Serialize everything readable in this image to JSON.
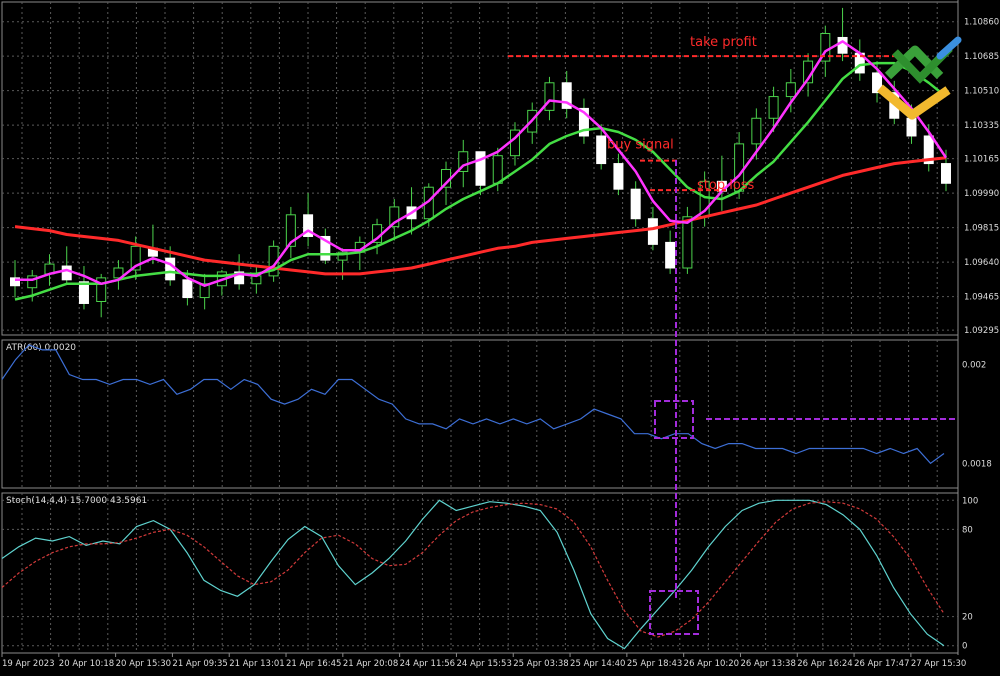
{
  "chart_data": [
    {
      "type": "candlestick",
      "panel": "price",
      "yaxis_ticks": [
        "1.10860",
        "1.10685",
        "1.10510",
        "1.10335",
        "1.10165",
        "1.09990",
        "1.09815",
        "1.09640",
        "1.09465",
        "1.09295"
      ],
      "ylim": [
        1.0927,
        1.1096
      ],
      "candles": [
        [
          1.0956,
          1.0965,
          1.0946,
          1.0952
        ],
        [
          1.0951,
          1.096,
          1.0944,
          1.0957
        ],
        [
          1.0958,
          1.0968,
          1.0952,
          1.0963
        ],
        [
          1.0962,
          1.0972,
          1.0953,
          1.0955
        ],
        [
          1.0954,
          1.0962,
          1.094,
          1.0943
        ],
        [
          1.0944,
          1.0958,
          1.0936,
          1.0956
        ],
        [
          1.0956,
          1.0965,
          1.095,
          1.0961
        ],
        [
          1.096,
          1.0977,
          1.0955,
          1.0972
        ],
        [
          1.0971,
          1.0983,
          1.0963,
          1.0967
        ],
        [
          1.0966,
          1.0972,
          1.0952,
          1.0955
        ],
        [
          1.0955,
          1.096,
          1.0942,
          1.0946
        ],
        [
          1.0946,
          1.0958,
          1.094,
          1.0953
        ],
        [
          1.0952,
          1.096,
          1.0947,
          1.0959
        ],
        [
          1.0959,
          1.0968,
          1.095,
          1.0953
        ],
        [
          1.0953,
          1.0962,
          1.0948,
          1.0957
        ],
        [
          1.0957,
          1.0975,
          1.0954,
          1.0972
        ],
        [
          1.0972,
          1.0992,
          1.0966,
          1.0988
        ],
        [
          1.0988,
          1.0999,
          1.0972,
          1.0977
        ],
        [
          1.0977,
          1.0981,
          1.0963,
          1.0965
        ],
        [
          1.0965,
          1.0971,
          1.0955,
          1.0969
        ],
        [
          1.0969,
          1.0977,
          1.096,
          1.0974
        ],
        [
          1.0974,
          1.0986,
          1.0968,
          1.0983
        ],
        [
          1.0982,
          1.0996,
          1.0975,
          1.0992
        ],
        [
          1.0992,
          1.1002,
          1.0978,
          1.0986
        ],
        [
          1.0986,
          1.1004,
          1.0982,
          1.1002
        ],
        [
          1.1002,
          1.1015,
          1.0993,
          1.1011
        ],
        [
          1.101,
          1.1026,
          1.1002,
          1.102
        ],
        [
          1.102,
          1.1017,
          1.0998,
          1.1003
        ],
        [
          1.1004,
          1.1022,
          1.1,
          1.1018
        ],
        [
          1.1018,
          1.1035,
          1.1013,
          1.1031
        ],
        [
          1.103,
          1.1045,
          1.1024,
          1.1041
        ],
        [
          1.1041,
          1.1058,
          1.1036,
          1.1055
        ],
        [
          1.1055,
          1.1061,
          1.1037,
          1.1042
        ],
        [
          1.1042,
          1.1047,
          1.1024,
          1.1028
        ],
        [
          1.1028,
          1.1034,
          1.1011,
          1.1014
        ],
        [
          1.1014,
          1.1019,
          1.0998,
          1.1001
        ],
        [
          1.1001,
          1.1005,
          1.0982,
          1.0986
        ],
        [
          1.0986,
          1.0992,
          1.097,
          1.0973
        ],
        [
          1.0974,
          1.098,
          1.0958,
          1.0961
        ],
        [
          1.0961,
          1.0992,
          1.0958,
          1.0987
        ],
        [
          1.0987,
          1.101,
          1.0982,
          1.1005
        ],
        [
          1.1005,
          1.1018,
          1.099,
          1.1
        ],
        [
          1.1,
          1.103,
          1.0996,
          1.1024
        ],
        [
          1.1024,
          1.1042,
          1.1016,
          1.1037
        ],
        [
          1.1037,
          1.1053,
          1.103,
          1.1048
        ],
        [
          1.1048,
          1.1062,
          1.104,
          1.1055
        ],
        [
          1.1055,
          1.107,
          1.1048,
          1.1066
        ],
        [
          1.1066,
          1.1084,
          1.1058,
          1.108
        ],
        [
          1.1078,
          1.1093,
          1.1066,
          1.107
        ],
        [
          1.107,
          1.1077,
          1.1056,
          1.106
        ],
        [
          1.106,
          1.1066,
          1.1045,
          1.105
        ],
        [
          1.105,
          1.1056,
          1.1034,
          1.1037
        ],
        [
          1.1037,
          1.1044,
          1.1024,
          1.1028
        ],
        [
          1.1028,
          1.1034,
          1.101,
          1.1014
        ],
        [
          1.1014,
          1.1021,
          1.1,
          1.1004
        ]
      ],
      "series": [
        {
          "name": "",
          "color": "#ff2a2a",
          "values": [
            1.0982,
            1.0981,
            1.098,
            1.0978,
            1.0977,
            1.0976,
            1.0975,
            1.0973,
            1.0971,
            1.0969,
            1.0967,
            1.0965,
            1.0964,
            1.0963,
            1.0962,
            1.0961,
            1.096,
            1.0959,
            1.0958,
            1.0958,
            1.0958,
            1.0959,
            1.096,
            1.0961,
            1.0963,
            1.0965,
            1.0967,
            1.0969,
            1.0971,
            1.0972,
            1.0974,
            1.0975,
            1.0976,
            1.0977,
            1.0978,
            1.0979,
            1.098,
            1.0981,
            1.0983,
            1.0985,
            1.0987,
            1.0989,
            1.0991,
            1.0993,
            1.0996,
            1.0999,
            1.1002,
            1.1005,
            1.1008,
            1.101,
            1.1012,
            1.1014,
            1.1015,
            1.1016,
            1.1017
          ]
        },
        {
          "name": "",
          "color": "#44dd44",
          "values": [
            1.0945,
            1.0947,
            1.095,
            1.0953,
            1.0953,
            1.0953,
            1.0955,
            1.0957,
            1.0958,
            1.0959,
            1.0958,
            1.0957,
            1.0957,
            1.0958,
            1.0958,
            1.096,
            1.0965,
            1.0968,
            1.0968,
            1.0968,
            1.0969,
            1.0972,
            1.0976,
            1.098,
            1.0985,
            1.0991,
            1.0996,
            1.1,
            1.1004,
            1.101,
            1.1016,
            1.1024,
            1.1028,
            1.1031,
            1.1032,
            1.103,
            1.1026,
            1.102,
            1.1011,
            1.1002,
            1.0997,
            1.0996,
            1.1,
            1.1008,
            1.1015,
            1.1025,
            1.1035,
            1.1046,
            1.1057,
            1.1064,
            1.1065,
            1.1065,
            1.1061,
            1.1055,
            1.1048
          ]
        },
        {
          "name": "",
          "color": "#ff33ff",
          "values": [
            1.0955,
            1.0955,
            1.0958,
            1.096,
            1.0957,
            1.0953,
            1.0955,
            1.0962,
            1.0966,
            1.0963,
            1.0956,
            1.0952,
            1.0955,
            1.0958,
            1.0957,
            1.0962,
            1.0974,
            1.098,
            1.0975,
            1.097,
            1.097,
            1.0976,
            1.0984,
            1.0989,
            1.0995,
            1.1004,
            1.1013,
            1.1016,
            1.102,
            1.1027,
            1.1036,
            1.1046,
            1.1045,
            1.104,
            1.1032,
            1.1021,
            1.101,
            1.0995,
            1.0985,
            1.0984,
            1.099,
            1.1,
            1.1008,
            1.102,
            1.1032,
            1.1045,
            1.1057,
            1.1071,
            1.1076,
            1.107,
            1.1062,
            1.1052,
            1.1042,
            1.103,
            1.1017
          ]
        }
      ],
      "annotations": [
        {
          "text": "take profit",
          "level": 1.10685,
          "color": "#ff2a2a"
        },
        {
          "text": "buy signal",
          "level": 1.10165,
          "color": "#ff2a2a"
        },
        {
          "text": "stop loss",
          "level": 1.0999,
          "color": "#ff2a2a"
        }
      ]
    },
    {
      "type": "line",
      "panel": "atr",
      "title": "ATR(60) 0.0020",
      "yaxis_ticks": [
        "0.002",
        "0.0018"
      ],
      "ylim": [
        0.00175,
        0.00205
      ],
      "series": [
        {
          "name": "",
          "color": "#3d6fd6",
          "values": [
            0.00197,
            0.00201,
            0.00204,
            0.00203,
            0.00203,
            0.00198,
            0.00197,
            0.00197,
            0.00196,
            0.00197,
            0.00197,
            0.00196,
            0.00197,
            0.00194,
            0.00195,
            0.00197,
            0.00197,
            0.00195,
            0.00197,
            0.00196,
            0.00193,
            0.00192,
            0.00193,
            0.00195,
            0.00194,
            0.00197,
            0.00197,
            0.00195,
            0.00193,
            0.00192,
            0.00189,
            0.00188,
            0.00188,
            0.00187,
            0.00189,
            0.00188,
            0.00189,
            0.00188,
            0.00189,
            0.00188,
            0.00189,
            0.00187,
            0.00188,
            0.00189,
            0.00191,
            0.0019,
            0.00189,
            0.00186,
            0.00186,
            0.00185,
            0.00186,
            0.00186,
            0.00184,
            0.00183,
            0.00184,
            0.00184,
            0.00183,
            0.00183,
            0.00183,
            0.00182,
            0.00183,
            0.00183,
            0.00183,
            0.00183,
            0.00183,
            0.00182,
            0.00183,
            0.00182,
            0.00183,
            0.0018,
            0.00182
          ]
        }
      ]
    },
    {
      "type": "line",
      "panel": "stochastic",
      "title": "Stoch(14,4,4) 15.7000 43.5961",
      "yaxis_ticks": [
        "100",
        "80",
        "20",
        "0"
      ],
      "ylim": [
        -5,
        105
      ],
      "series": [
        {
          "name": "",
          "color": "#5fd3cf",
          "values": [
            60,
            68,
            74,
            72,
            75,
            69,
            72,
            70,
            82,
            86,
            80,
            64,
            45,
            38,
            34,
            42,
            58,
            73,
            82,
            75,
            55,
            42,
            50,
            60,
            72,
            87,
            100,
            93,
            96,
            99,
            98,
            96,
            93,
            78,
            52,
            22,
            5,
            -2,
            12,
            25,
            38,
            52,
            68,
            82,
            93,
            98,
            100,
            100,
            100,
            97,
            90,
            80,
            62,
            40,
            22,
            8,
            0
          ]
        },
        {
          "name": "",
          "color": "#d23a3a",
          "dashed": true,
          "values": [
            40,
            50,
            58,
            64,
            68,
            70,
            70,
            71,
            74,
            78,
            80,
            76,
            68,
            58,
            48,
            42,
            44,
            52,
            64,
            74,
            76,
            70,
            60,
            55,
            56,
            64,
            76,
            86,
            92,
            95,
            97,
            98,
            97,
            94,
            85,
            68,
            45,
            24,
            10,
            6,
            10,
            18,
            30,
            44,
            58,
            72,
            85,
            94,
            98,
            99,
            98,
            94,
            87,
            75,
            60,
            40,
            22
          ]
        }
      ]
    }
  ],
  "xaxis_ticks": [
    "19 Apr 2023",
    "20 Apr 10:18",
    "20 Apr 15:30",
    "21 Apr 09:35",
    "21 Apr 13:01",
    "21 Apr 16:45",
    "21 Apr 20:08",
    "24 Apr 11:56",
    "24 Apr 15:53",
    "25 Apr 03:38",
    "25 Apr 14:40",
    "25 Apr 18:43",
    "26 Apr 10:20",
    "26 Apr 13:38",
    "26 Apr 16:24",
    "26 Apr 17:47",
    "27 Apr 15:30"
  ],
  "colors": {
    "background": "#000000",
    "grid": "#5a5a5a",
    "text": "#dcdcdc",
    "signal": "#a32cdb"
  }
}
